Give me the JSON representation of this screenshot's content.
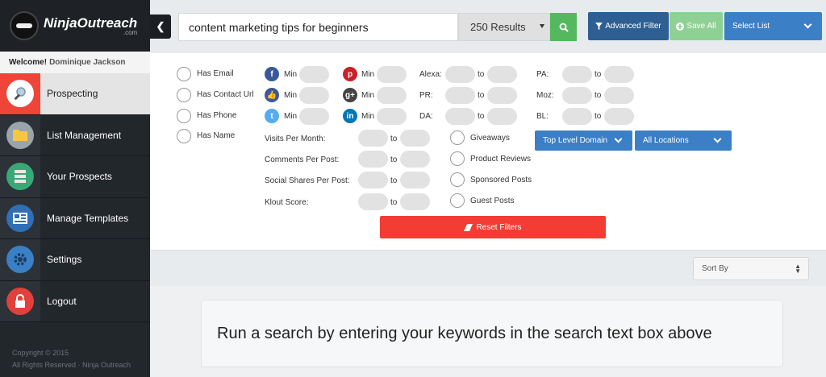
{
  "app": {
    "logo_text": "NinjaOutreach",
    "logo_sub": ".com"
  },
  "sidebar": {
    "welcome_label": "Welcome!",
    "user_name": "Dominique Jackson",
    "items": [
      {
        "label": "Prospecting",
        "icon": "magnifier-icon",
        "color": "#ef4438"
      },
      {
        "label": "List Management",
        "icon": "folder-icon",
        "color": "#9aa4ad"
      },
      {
        "label": "Your Prospects",
        "icon": "database-icon",
        "color": "#3aa876"
      },
      {
        "label": "Manage Templates",
        "icon": "template-icon",
        "color": "#2f6fb5"
      },
      {
        "label": "Settings",
        "icon": "gear-icon",
        "color": "#3a80c6"
      },
      {
        "label": "Logout",
        "icon": "lock-icon",
        "color": "#e2403a"
      }
    ],
    "copyright_line1": "Copyright © 2015",
    "copyright_line2": "All Rights Reserved · Ninja Outreach"
  },
  "topbar": {
    "search_value": "content marketing tips for beginners",
    "results_label": "250 Results",
    "advanced_filter_label": "Advanced Filter",
    "save_all_label": "Save All",
    "select_list_label": "Select List"
  },
  "filters": {
    "checks": [
      "Has Email",
      "Has Contact Url",
      "Has Phone",
      "Has Name"
    ],
    "min_label": "Min",
    "to_label": "to",
    "alexa": "Alexa:",
    "pr": "PR:",
    "da": "DA:",
    "pa": "PA:",
    "moz": "Moz:",
    "bl": "BL:",
    "visits": "Visits Per Month:",
    "comments": "Comments Per Post:",
    "shares": "Social Shares Per Post:",
    "klout": "Klout Score:",
    "types": [
      "Giveaways",
      "Product Reviews",
      "Sponsored Posts",
      "Guest Posts"
    ],
    "tld_label": "Top Level Domain",
    "locations_label": "All Locations",
    "reset_label": "Reset Filters"
  },
  "sort": {
    "label": "Sort By"
  },
  "message": "Run a search by entering your keywords in the search text box above"
}
